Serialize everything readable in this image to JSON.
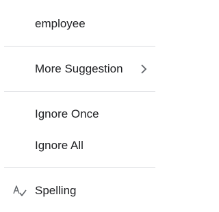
{
  "menu": {
    "suggestion": "employee",
    "more_suggestion": "More Suggestion",
    "more_icon": "chevron-right-icon",
    "ignore_once": "Ignore Once",
    "ignore_all": "Ignore All",
    "spelling": "Spelling",
    "spelling_icon": "spellcheck-icon"
  },
  "colors": {
    "text": "#202124",
    "icon": "#5f6368",
    "divider": "#dadce0",
    "background": "#ffffff"
  }
}
